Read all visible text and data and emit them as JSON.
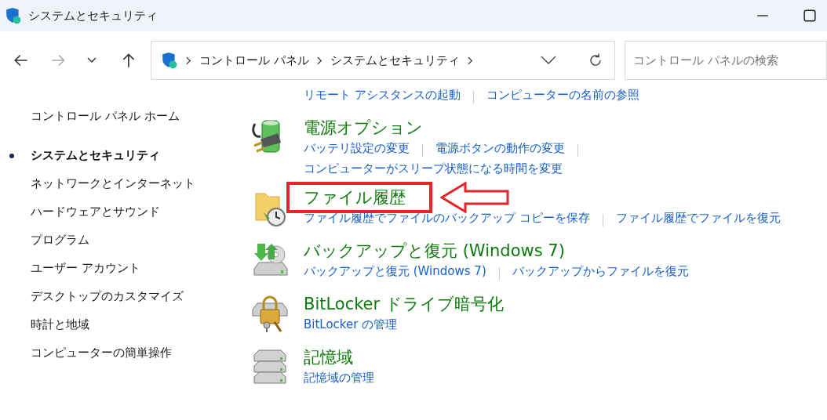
{
  "window": {
    "title": "システムとセキュリティ"
  },
  "nav": {
    "back_disabled": false,
    "forward_disabled": true
  },
  "address": {
    "crumbs": [
      "コントロール パネル",
      "システムとセキュリティ"
    ]
  },
  "search": {
    "placeholder": "コントロール パネルの検索"
  },
  "sidebar": {
    "items": [
      {
        "label": "コントロール パネル ホーム",
        "selected": false,
        "kind": "home"
      },
      {
        "label": "システムとセキュリティ",
        "selected": true,
        "kind": "category"
      },
      {
        "label": "ネットワークとインターネット",
        "selected": false,
        "kind": "category"
      },
      {
        "label": "ハードウェアとサウンド",
        "selected": false,
        "kind": "category"
      },
      {
        "label": "プログラム",
        "selected": false,
        "kind": "category"
      },
      {
        "label": "ユーザー アカウント",
        "selected": false,
        "kind": "category"
      },
      {
        "label": "デスクトップのカスタマイズ",
        "selected": false,
        "kind": "category"
      },
      {
        "label": "時計と地域",
        "selected": false,
        "kind": "category"
      },
      {
        "label": "コンピューターの簡単操作",
        "selected": false,
        "kind": "category"
      }
    ]
  },
  "sections": [
    {
      "kind": "partial",
      "links": [
        "リモート アシスタンスの起動",
        "コンピューターの名前の参照"
      ]
    },
    {
      "kind": "power",
      "title": "電源オプション",
      "highlighted": false,
      "links": [
        "バッテリ設定の変更",
        "電源ボタンの動作の変更",
        "コンピューターがスリープ状態になる時間を変更"
      ]
    },
    {
      "kind": "file-history",
      "title": "ファイル履歴",
      "highlighted": true,
      "links": [
        "ファイル履歴でファイルのバックアップ コピーを保存",
        "ファイル履歴でファイルを復元"
      ]
    },
    {
      "kind": "backup",
      "title": "バックアップと復元 (Windows 7)",
      "highlighted": false,
      "links": [
        "バックアップと復元 (Windows 7)",
        "バックアップからファイルを復元"
      ]
    },
    {
      "kind": "bitlocker",
      "title": "BitLocker ドライブ暗号化",
      "highlighted": false,
      "links": [
        "BitLocker の管理"
      ]
    },
    {
      "kind": "storage",
      "title": "記憶域",
      "highlighted": false,
      "links": [
        "記憶域の管理"
      ]
    }
  ]
}
